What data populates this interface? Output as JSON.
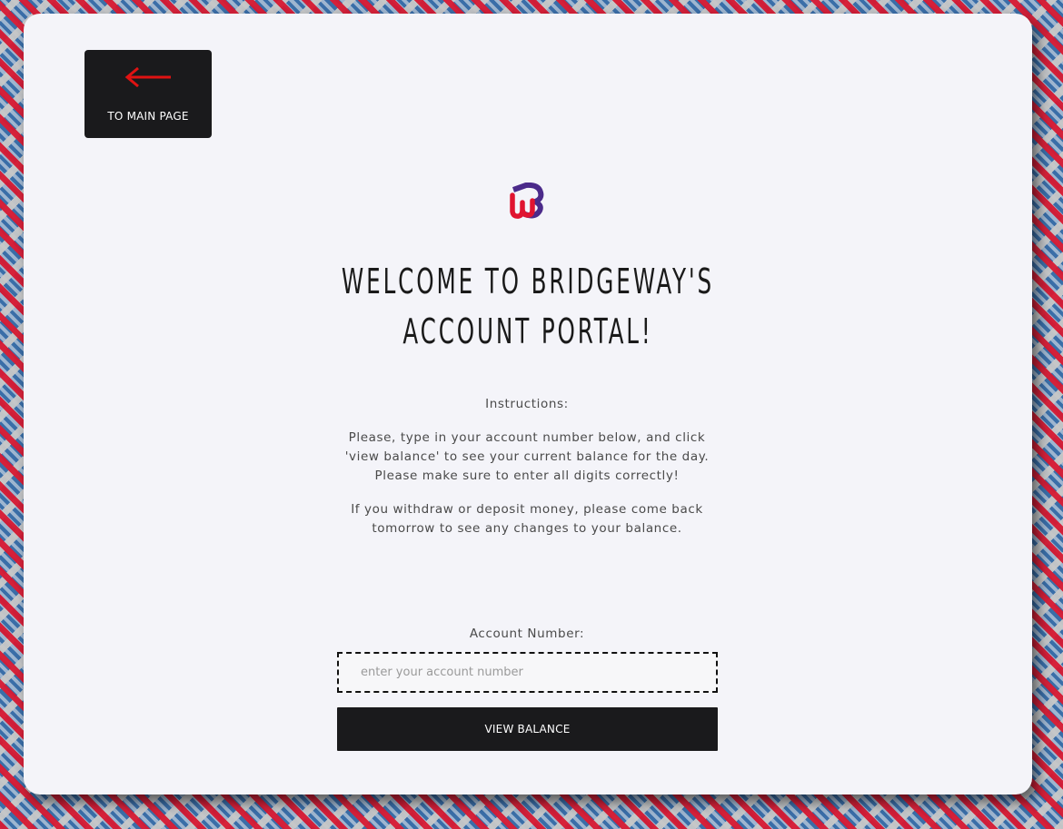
{
  "nav": {
    "back_label": "TO MAIN PAGE"
  },
  "header": {
    "title": "WELCOME TO BRIDGEWAY'S ACCOUNT PORTAL!"
  },
  "instructions": {
    "heading": "Instructions:",
    "paragraph_1": "Please, type in your account number below, and click 'view balance' to see your current balance for the day. Please make sure to enter all digits correctly!",
    "paragraph_2": "If you withdraw or deposit money, please come back tomorrow to see any changes to your balance."
  },
  "form": {
    "account_label": "Account Number:",
    "account_placeholder": "enter your account number",
    "account_value": "",
    "submit_label": "VIEW BALANCE"
  },
  "icons": {
    "back": "left-arrow-icon",
    "logo": "bridgeway-logo"
  },
  "colors": {
    "arrow": "#e01212",
    "logo_purple": "#4b2a8a",
    "logo_red": "#e01430",
    "button_dark": "#1a1a1c",
    "card_bg": "#f4f4f9"
  }
}
